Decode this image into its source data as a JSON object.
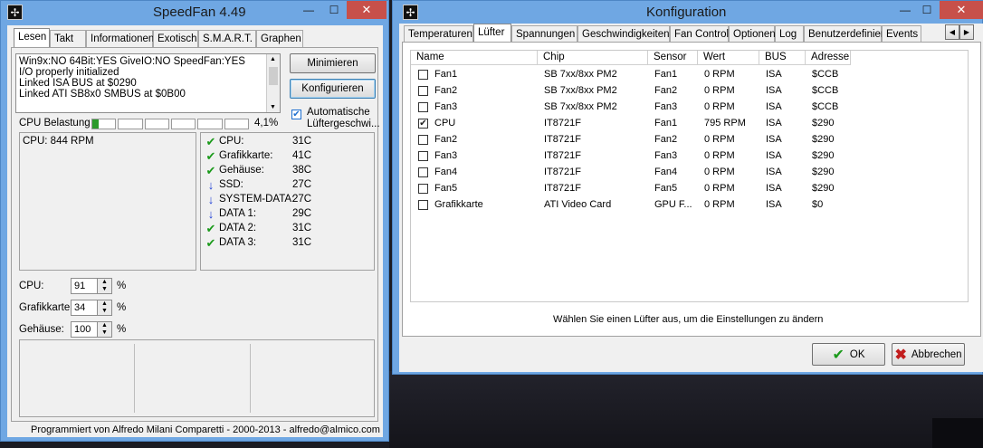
{
  "speedfan": {
    "title": "SpeedFan 4.49",
    "tabs": [
      "Lesen",
      "Takt",
      "Informationen",
      "Exotisch",
      "S.M.A.R.T.",
      "Graphen"
    ],
    "active_tab": "Lesen",
    "log": [
      "Win9x:NO  64Bit:YES  GiveIO:NO  SpeedFan:YES",
      "I/O properly initialized",
      "Linked ISA BUS at $0290",
      "Linked ATI SB8x0 SMBUS at $0B00"
    ],
    "minimize_label": "Minimieren",
    "configure_label": "Konfigurieren",
    "auto_fan_label_1": "Automatische",
    "auto_fan_label_2": "Lüftergeschwi...",
    "cpu_load_label": "CPU Belastung",
    "cpu_load_value": "4,1%",
    "cpu_load_fraction": 0.041,
    "fan_readings": [
      "CPU: 844 RPM"
    ],
    "temperatures": [
      {
        "name": "CPU:",
        "value": "31C",
        "icon": "check-icon"
      },
      {
        "name": "Grafikkarte:",
        "value": "41C",
        "icon": "check-icon"
      },
      {
        "name": "Gehäuse:",
        "value": "38C",
        "icon": "check-icon"
      },
      {
        "name": "SSD:",
        "value": "27C",
        "icon": "arrow-down-icon"
      },
      {
        "name": "SYSTEM-DATA:",
        "value": "27C",
        "icon": "arrow-down-icon"
      },
      {
        "name": "DATA 1:",
        "value": "29C",
        "icon": "arrow-down-icon"
      },
      {
        "name": "DATA 2:",
        "value": "31C",
        "icon": "check-icon"
      },
      {
        "name": "DATA 3:",
        "value": "31C",
        "icon": "check-icon"
      }
    ],
    "speeds": [
      {
        "label": "CPU:",
        "value": "91",
        "unit": "%"
      },
      {
        "label": "Grafikkarte:",
        "value": "34",
        "unit": "%"
      },
      {
        "label": "Gehäuse:",
        "value": "100",
        "unit": "%"
      }
    ],
    "footer": "Programmiert von Alfredo Milani Comparetti - 2000-2013 - alfredo@almico.com"
  },
  "config": {
    "title": "Konfiguration",
    "tabs": [
      "Temperaturen",
      "Lüfter",
      "Spannungen",
      "Geschwindigkeiten",
      "Fan Control",
      "Optionen",
      "Log",
      "Benutzerdefiniert",
      "Events"
    ],
    "active_tab": "Lüfter",
    "columns": [
      "Name",
      "Chip",
      "Sensor",
      "Wert",
      "BUS",
      "Adresse"
    ],
    "rows": [
      {
        "checked": false,
        "name": "Fan1",
        "chip": "SB 7xx/8xx PM2",
        "sensor": "Fan1",
        "wert": "0 RPM",
        "bus": "ISA",
        "adresse": "$CCB"
      },
      {
        "checked": false,
        "name": "Fan2",
        "chip": "SB 7xx/8xx PM2",
        "sensor": "Fan2",
        "wert": "0 RPM",
        "bus": "ISA",
        "adresse": "$CCB"
      },
      {
        "checked": false,
        "name": "Fan3",
        "chip": "SB 7xx/8xx PM2",
        "sensor": "Fan3",
        "wert": "0 RPM",
        "bus": "ISA",
        "adresse": "$CCB"
      },
      {
        "checked": true,
        "name": "CPU",
        "chip": "IT8721F",
        "sensor": "Fan1",
        "wert": "795 RPM",
        "bus": "ISA",
        "adresse": "$290"
      },
      {
        "checked": false,
        "name": "Fan2",
        "chip": "IT8721F",
        "sensor": "Fan2",
        "wert": "0 RPM",
        "bus": "ISA",
        "adresse": "$290"
      },
      {
        "checked": false,
        "name": "Fan3",
        "chip": "IT8721F",
        "sensor": "Fan3",
        "wert": "0 RPM",
        "bus": "ISA",
        "adresse": "$290"
      },
      {
        "checked": false,
        "name": "Fan4",
        "chip": "IT8721F",
        "sensor": "Fan4",
        "wert": "0 RPM",
        "bus": "ISA",
        "adresse": "$290"
      },
      {
        "checked": false,
        "name": "Fan5",
        "chip": "IT8721F",
        "sensor": "Fan5",
        "wert": "0 RPM",
        "bus": "ISA",
        "adresse": "$290"
      },
      {
        "checked": false,
        "name": "Grafikkarte",
        "chip": "ATI Video Card",
        "sensor": "GPU F...",
        "wert": "0 RPM",
        "bus": "ISA",
        "adresse": "$0"
      }
    ],
    "hint": "Wählen Sie einen Lüfter aus, um die Einstellungen zu ändern",
    "ok_label": "OK",
    "cancel_label": "Abbrechen"
  }
}
